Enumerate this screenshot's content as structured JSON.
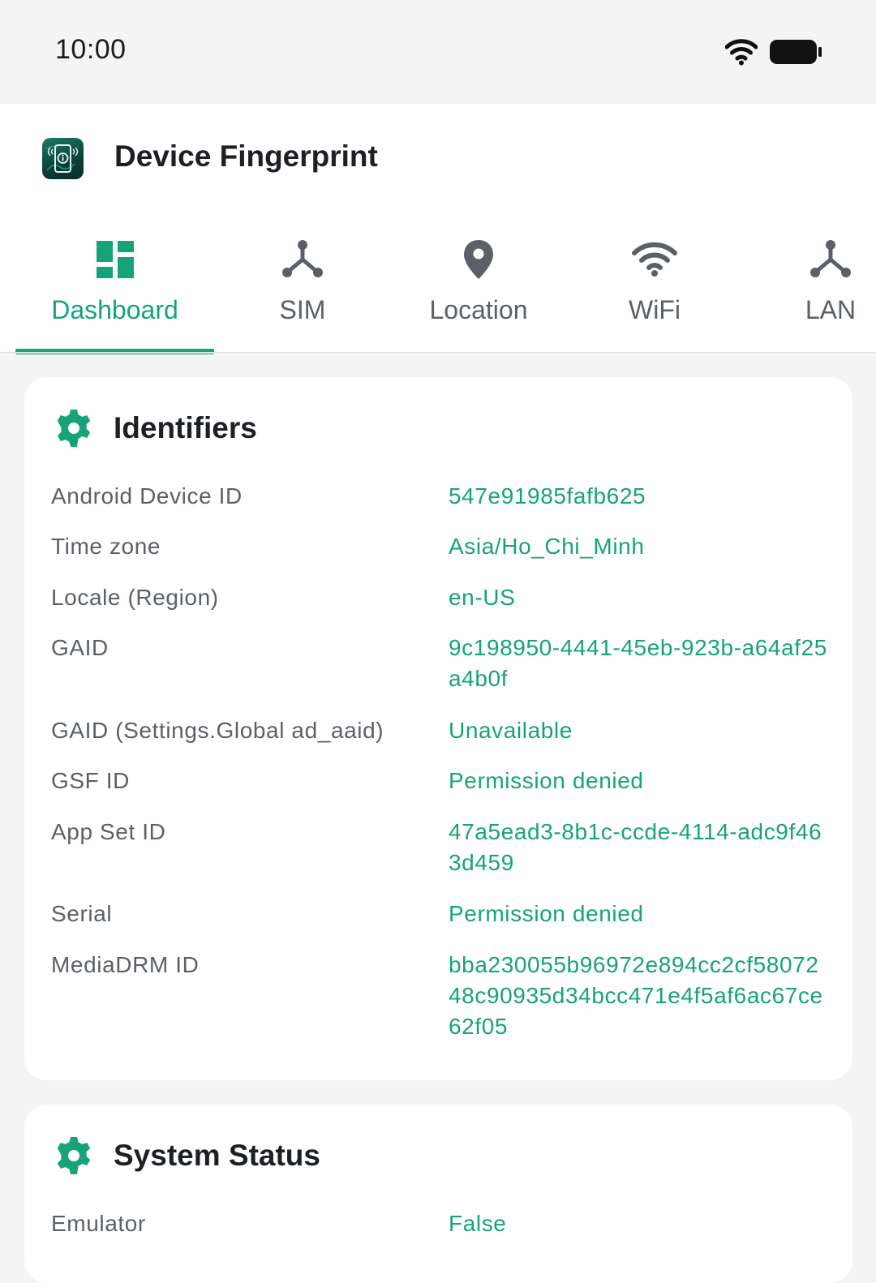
{
  "status_bar": {
    "time": "10:00",
    "icons": [
      "wifi-icon",
      "battery-icon"
    ]
  },
  "app": {
    "title": "Device Fingerprint",
    "accent": "#17a37a"
  },
  "tabs": [
    {
      "label": "Dashboard",
      "icon": "dashboard-icon",
      "active": true
    },
    {
      "label": "SIM",
      "icon": "network-icon",
      "active": false
    },
    {
      "label": "Location",
      "icon": "location-pin-icon",
      "active": false
    },
    {
      "label": "WiFi",
      "icon": "wifi-icon",
      "active": false
    },
    {
      "label": "LAN",
      "icon": "network-icon",
      "active": false
    }
  ],
  "identifiers": {
    "title": "Identifiers",
    "icon": "gear-icon",
    "rows": [
      {
        "key": "Android Device ID",
        "value": "547e91985fafb625"
      },
      {
        "key": "Time zone",
        "value": "Asia/Ho_Chi_Minh"
      },
      {
        "key": "Locale (Region)",
        "value": "en-US"
      },
      {
        "key": "GAID",
        "value": "9c198950-4441-45eb-923b-a64af25a4b0f"
      },
      {
        "key": "GAID (Settings.Global ad_aaid)",
        "value": "Unavailable"
      },
      {
        "key": "GSF ID",
        "value": "Permission denied"
      },
      {
        "key": "App Set ID",
        "value": "47a5ead3-8b1c-ccde-4114-adc9f463d459"
      },
      {
        "key": "Serial",
        "value": "Permission denied"
      },
      {
        "key": "MediaDRM ID",
        "value": "bba230055b96972e894cc2cf5807248c90935d34bcc471e4f5af6ac67ce62f05"
      }
    ]
  },
  "system_status": {
    "title": "System Status",
    "icon": "gear-icon",
    "rows": [
      {
        "key": "Emulator",
        "value": "False"
      }
    ]
  }
}
